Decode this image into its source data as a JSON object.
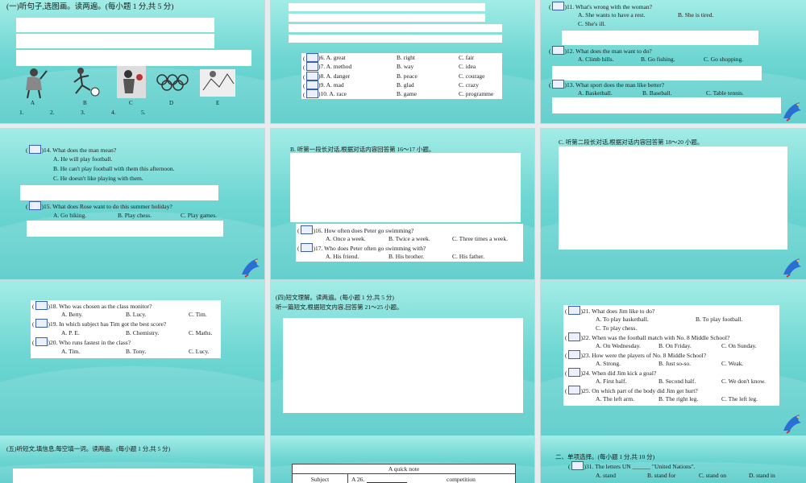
{
  "s1": {
    "header": "(一)听句子,选图画。读两遍。(每小题 1 分,共 5 分)",
    "pic_labels": [
      "A",
      "B",
      "C",
      "D",
      "E"
    ],
    "answer_line": [
      "1.",
      "2.",
      "3.",
      "4.",
      "5."
    ]
  },
  "s2": {
    "rows": [
      {
        "num": ")6. A. great",
        "b": "B. right",
        "c": "C. fair"
      },
      {
        "num": ")7. A. method",
        "b": "B. way",
        "c": "C. idea"
      },
      {
        "num": ")8. A. danger",
        "b": "B. peace",
        "c": "C. courage"
      },
      {
        "num": ")9. A. mad",
        "b": "B. glad",
        "c": "C. crazy"
      },
      {
        "num": ")10. A. race",
        "b": "B. game",
        "c": "C. programme"
      }
    ]
  },
  "s3": {
    "q11": ")11. What's wrong with the woman?",
    "q11a": "A. She wants to have a rest.",
    "q11b": "B. She is tired.",
    "q11c": "C. She's ill.",
    "q12": ")12. What does the man want to do?",
    "q12a": "A. Climb hills.",
    "q12b": "B. Go fishing.",
    "q12c": "C. Go shopping.",
    "q13": ")13. What sport does the man like better?",
    "q13a": "A. Basketball.",
    "q13b": "B. Baseball.",
    "q13c": "C. Table tennis."
  },
  "s4": {
    "q14": ")14. What does the man mean?",
    "q14a": "A. He will play football.",
    "q14b": "B. He can't play football with them this afternoon.",
    "q14c": "C. He doesn't like playing with them.",
    "q15": ")15. What does Rose want to do this summer holiday?",
    "q15a": "A. Go hiking.",
    "q15b": "B. Play chess.",
    "q15c": "C. Play games."
  },
  "s5": {
    "header": "B. 听第一段长对话,根据对话内容回答第 16～17 小题。",
    "q16": ")16. How often does Peter go swimming?",
    "q16a": "A. Once a week.",
    "q16b": "B. Twice a week.",
    "q16c": "C. Three times a week.",
    "q17": ")17. Who does Peter often go swimming with?",
    "q17a": "A. His friend.",
    "q17b": "B. His brother.",
    "q17c": "C. His father."
  },
  "s6": {
    "header": "C. 听第二段长对话,根据对话内容回答第 18～20 小题。"
  },
  "s7": {
    "q18": ")18. Who was chosen as the class monitor?",
    "q18a": "A. Betty.",
    "q18b": "B. Lucy.",
    "q18c": "C. Tim.",
    "q19": ")19. In which subject has Tim got the best score?",
    "q19a": "A. P. E.",
    "q19b": "B. Chemistry.",
    "q19c": "C. Maths.",
    "q20": ")20. Who runs fastest in the class?",
    "q20a": "A. Tim.",
    "q20b": "B. Tony.",
    "q20c": "C. Lucy."
  },
  "s8": {
    "header1": "(四)短文理解。读两遍。(每小题 1 分,共 5 分)",
    "header2": "听一篇短文,根据短文内容,回答第 21～25 小题。"
  },
  "s9": {
    "q21": ")21. What does Jim like to do?",
    "q21a": "A. To play basketball.",
    "q21b": "B. To play football.",
    "q21c": "C. To play chess.",
    "q22": ")22. When was the football match with No. 8 Middle School?",
    "q22a": "A. On Wednesday.",
    "q22b": "B. On Friday.",
    "q22c": "C. On Sunday.",
    "q23": ")23. How were the players of No. 8 Middle School?",
    "q23a": "A. Strong.",
    "q23b": "B. Just so-so.",
    "q23c": "C. Weak.",
    "q24": ")24. When did Jim kick a goal?",
    "q24a": "A. First half.",
    "q24b": "B. Second half.",
    "q24c": "C. We don't know.",
    "q25": ")25. On which part of the body did Jim get hurt?",
    "q25a": "A. The left arm.",
    "q25b": "B. The right leg.",
    "q25c": "C. The left leg."
  },
  "s10": {
    "header": "(五)听短文,填信息,每空填一词。读两遍。(每小题 1 分,共 5 分)"
  },
  "s11": {
    "title": "A quick note",
    "col1": "Subject",
    "col2": "A 26.",
    "col3": "competition"
  },
  "s12": {
    "header": "二、单项选择。(每小题 1 分,共 10 分)",
    "q31": ")31. The letters UN ______ \"United Nations\".",
    "q31a": "A. stand",
    "q31b": "B. stand for",
    "q31c": "C. stand on",
    "q31d": "D. stand in"
  },
  "colors": {
    "slide_top": "#a3ece6",
    "slide_bottom": "#4fc9c7",
    "bracket": "#3a5fb0"
  }
}
